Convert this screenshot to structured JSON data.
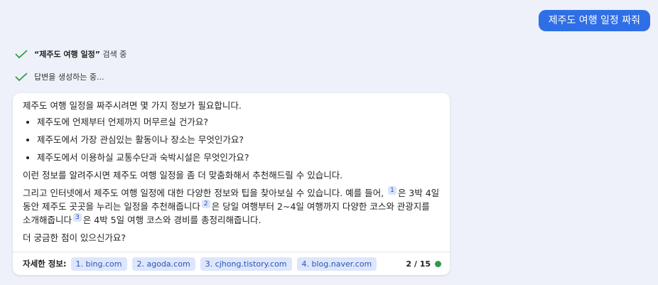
{
  "user_message": "제주도 여행 일정 짜줘",
  "status": {
    "search_query": "“제주도 여행 일정”",
    "search_suffix": " 검색 중",
    "generating": "답변을 생성하는 중..."
  },
  "answer": {
    "intro": "제주도 여행 일정을 짜주시려면 몇 가지 정보가 필요합니다.",
    "questions": [
      "제주도에 언제부터 언제까지 머무르실 건가요?",
      "제주도에서 가장 관심있는 활동이나 장소는 무엇인가요?",
      "제주도에서 이용하실 교통수단과 숙박시설은 무엇인가요?"
    ],
    "para2": "이런 정보를 알려주시면 제주도 여행 일정을 좀 더 맞춤화해서 추천해드릴 수 있습니다.",
    "para3_a": "그리고 인터넷에서 제주도 여행 일정에 대한 다양한 정보와 팁을 찾아보실 수 있습니다. 예를 들어,",
    "ref1": "1",
    "para3_b": "은 3박 4일 동안 제주도 곳곳을 누리는 일정을 추천해줍니다",
    "ref2": "2",
    "para3_c": "은 당일 여행부터 2~4일 여행까지 다양한 코스와 관광지를 소개해줍니다",
    "ref3": "3",
    "para3_d": "은 4박 5일 여행 코스와 경비를 총정리해줍니다.",
    "closing": "더 궁금한 점이 있으신가요?"
  },
  "footer": {
    "label": "자세한 정보:",
    "sources": [
      "1. bing.com",
      "2. agoda.com",
      "3. cjhong.tistory.com",
      "4. blog.naver.com"
    ],
    "count": "2 / 15",
    "status_color": "#2f9b4b"
  },
  "colors": {
    "accent": "#2f6fe6",
    "check": "#2e9e44",
    "chip_bg": "#dde6fb"
  },
  "icons": {
    "status": "check-icon",
    "indicator": "status-dot"
  }
}
